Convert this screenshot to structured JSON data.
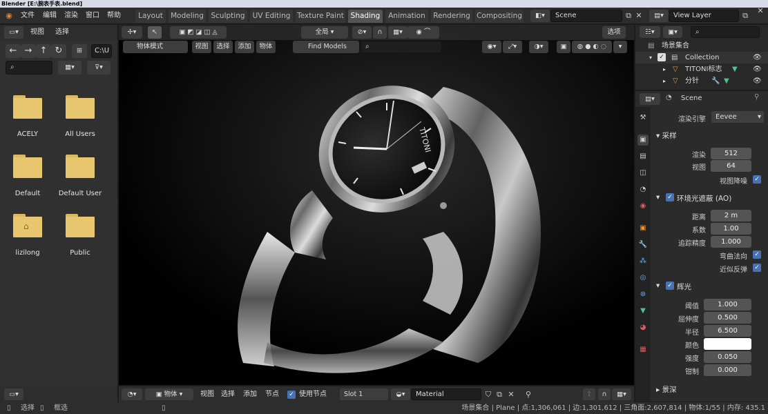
{
  "window": {
    "title": "Blender [E:\\腕表手表.blend]"
  },
  "menus": {
    "file": "文件",
    "edit": "编辑",
    "render": "渲染",
    "window": "窗口",
    "help": "帮助"
  },
  "workspaces": [
    "Layout",
    "Modeling",
    "Sculpting",
    "UV Editing",
    "Texture Paint",
    "Shading",
    "Animation",
    "Rendering",
    "Compositing"
  ],
  "active_workspace": "Shading",
  "scene_name": "Scene",
  "view_layer": "View Layer",
  "file_browser": {
    "view_menu": "视图",
    "select_menu": "选择",
    "path": "C:\\U",
    "folders": [
      "ACELY",
      "All Users",
      "Default",
      "Default User",
      "lizilong",
      "Public"
    ]
  },
  "viewport": {
    "mode": "物体模式",
    "view": "视图",
    "select": "选择",
    "add": "添加",
    "object": "物体",
    "find_models": "Find Models",
    "transform_orientation": "全局",
    "options": "选项"
  },
  "outliner": {
    "root": "场景集合",
    "collection": "Collection",
    "items": [
      "TITONI标志",
      "分针"
    ]
  },
  "properties": {
    "scene_label": "Scene",
    "render_engine_label": "渲染引擎",
    "render_engine": "Eevee",
    "sampling": {
      "title": "采样",
      "render_label": "渲染",
      "render_value": "512",
      "viewport_label": "视图",
      "viewport_value": "64",
      "denoise_label": "视图降噪"
    },
    "ao": {
      "title": "环境光遮蔽 (AO)",
      "distance_label": "距离",
      "distance": "2 m",
      "factor_label": "系数",
      "factor": "1.00",
      "trace_label": "追踪精度",
      "trace": "1.000",
      "bent_normals": "弯曲法向",
      "bounce_approx": "近似反弹"
    },
    "bloom": {
      "title": "辉光",
      "threshold_label": "阈值",
      "threshold": "1.000",
      "knee_label": "屈伸度",
      "knee": "0.500",
      "radius_label": "半径",
      "radius": "6.500",
      "color_label": "颜色",
      "intensity_label": "强度",
      "intensity": "0.050",
      "clamp_label": "钳制",
      "clamp": "0.000"
    },
    "dof": {
      "title": "景深"
    }
  },
  "shader_header": {
    "object": "物体",
    "view": "视图",
    "select": "选择",
    "add": "添加",
    "node": "节点",
    "use_nodes": "使用节点",
    "slot": "Slot 1",
    "material": "Material"
  },
  "status": {
    "select": "选择",
    "box_select": "框选",
    "stats": "场景集合 | Plane | 点:1,306,061 | 边:1,301,612 | 三角面:2,607,814 | 物体:1/55 | 内存: 435.1"
  },
  "colors": {
    "accent": "#4772b3",
    "folder": "#e8c56f",
    "active_tab": "#545454"
  }
}
